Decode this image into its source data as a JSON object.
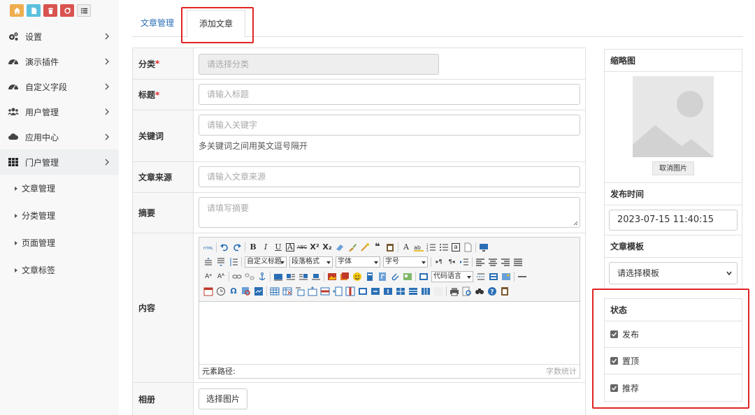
{
  "sidebar": {
    "items": [
      {
        "label": "设置",
        "icon": "gears-icon"
      },
      {
        "label": "演示插件",
        "icon": "dashboard-icon"
      },
      {
        "label": "自定义字段",
        "icon": "dashboard-icon"
      },
      {
        "label": "用户管理",
        "icon": "users-icon"
      },
      {
        "label": "应用中心",
        "icon": "cloud-icon"
      },
      {
        "label": "门户管理",
        "icon": "th-icon"
      }
    ],
    "subitems": [
      {
        "label": "文章管理"
      },
      {
        "label": "分类管理"
      },
      {
        "label": "页面管理"
      },
      {
        "label": "文章标签"
      }
    ]
  },
  "tabs": [
    {
      "label": "文章管理"
    },
    {
      "label": "添加文章"
    }
  ],
  "form": {
    "category": {
      "label": "分类",
      "required": "*",
      "placeholder": "请选择分类"
    },
    "title": {
      "label": "标题",
      "required": "*",
      "placeholder": "请输入标题"
    },
    "keywords": {
      "label": "关键词",
      "placeholder": "请输入关键字",
      "hint": "多关键词之间用英文逗号隔开"
    },
    "source": {
      "label": "文章来源",
      "placeholder": "请输入文章来源"
    },
    "summary": {
      "label": "摘要",
      "placeholder": "请填写摘要"
    },
    "content": {
      "label": "内容"
    },
    "album": {
      "label": "相册",
      "button": "选择图片"
    }
  },
  "editor": {
    "toolbar": {
      "custom_title": "自定义标题",
      "paragraph": "段落格式",
      "font": "字体",
      "size": "字号",
      "code_lang": "代码语言"
    },
    "footer_left": "元素路径:",
    "footer_right": "字数统计"
  },
  "right": {
    "thumbnail": {
      "label": "缩略图",
      "cancel": "取消图片"
    },
    "publish_time": {
      "label": "发布时间",
      "value": "2023-07-15 11:40:15"
    },
    "template": {
      "label": "文章模板",
      "placeholder": "请选择模板"
    },
    "status": {
      "label": "状态",
      "options": [
        {
          "label": "发布",
          "checked": true
        },
        {
          "label": "置顶",
          "checked": true
        },
        {
          "label": "推荐",
          "checked": true
        }
      ]
    }
  }
}
